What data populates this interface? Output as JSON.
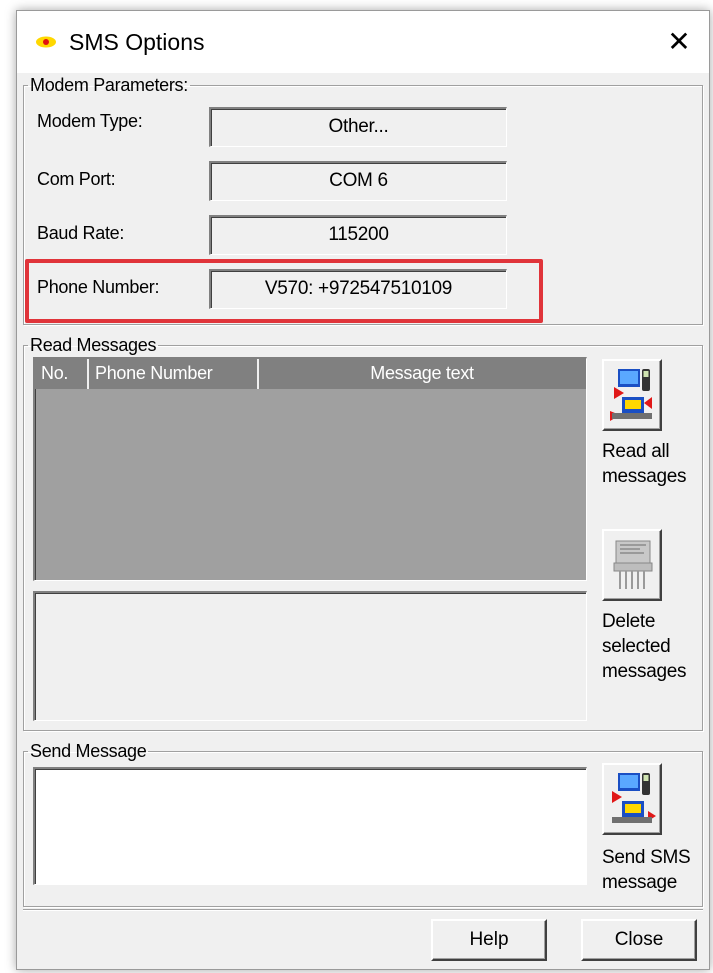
{
  "window": {
    "title": "SMS Options",
    "close_glyph": "✕"
  },
  "modem": {
    "legend": "Modem Parameters:",
    "rows": [
      {
        "label": "Modem Type:",
        "value": "Other..."
      },
      {
        "label": "Com Port:",
        "value": "COM 6"
      },
      {
        "label": "Baud Rate:",
        "value": "115200"
      },
      {
        "label": "Phone Number:",
        "value": "V570: +972547510109"
      }
    ]
  },
  "read": {
    "legend": "Read Messages",
    "columns": [
      "No.",
      "Phone Number",
      "Message text"
    ],
    "read_all_line1": "Read all",
    "read_all_line2": "messages",
    "delete_line1": "Delete",
    "delete_line2": "selected",
    "delete_line3": "messages"
  },
  "send": {
    "legend": "Send Message",
    "send_line1": "Send SMS",
    "send_line2": "message"
  },
  "footer": {
    "help": "Help",
    "close": "Close"
  },
  "colors": {
    "highlight": "#e0343a",
    "list_bg": "#a0a0a0",
    "header_bg": "#808080"
  },
  "icons": [
    "sms-app-icon",
    "read-messages-icon",
    "delete-messages-icon",
    "send-sms-icon"
  ]
}
